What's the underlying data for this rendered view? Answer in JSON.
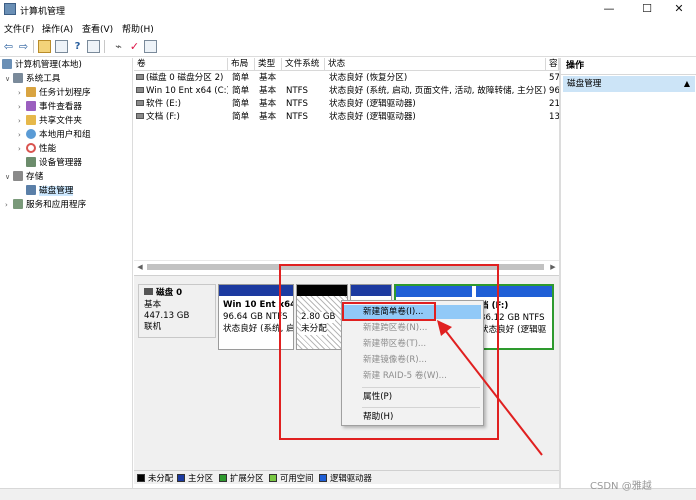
{
  "window": {
    "title": "计算机管理",
    "minimize": "—",
    "maximize": "☐",
    "close": "✕"
  },
  "menu": {
    "items": [
      {
        "label": "文件(F)",
        "name": "menu-file"
      },
      {
        "label": "操作(A)",
        "name": "menu-action"
      },
      {
        "label": "查看(V)",
        "name": "menu-view"
      },
      {
        "label": "帮助(H)",
        "name": "menu-help"
      }
    ]
  },
  "toolbar": {
    "icons": [
      "back-icon",
      "forward-icon",
      "up-folder-icon",
      "show-tree-icon",
      "help-icon",
      "properties-icon",
      "export-icon",
      "checklist-icon",
      "detail-icon"
    ]
  },
  "tree": {
    "items": [
      {
        "label": "计算机管理(本地)",
        "name": "tree-root",
        "level": 0,
        "arrow": "",
        "color": "#6a8fb5"
      },
      {
        "label": "系统工具",
        "name": "tree-system-tools",
        "level": 1,
        "arrow": "∨",
        "color": "#7a8a9a"
      },
      {
        "label": "任务计划程序",
        "name": "tree-task-scheduler",
        "level": 2,
        "arrow": "›",
        "color": "#d9a441"
      },
      {
        "label": "事件查看器",
        "name": "tree-event-viewer",
        "level": 2,
        "arrow": "›",
        "color": "#9b5fbf"
      },
      {
        "label": "共享文件夹",
        "name": "tree-shared-folders",
        "level": 2,
        "arrow": "›",
        "color": "#e6b84a"
      },
      {
        "label": "本地用户和组",
        "name": "tree-local-users",
        "level": 2,
        "arrow": "›",
        "color": "#5a9bd5"
      },
      {
        "label": "性能",
        "name": "tree-performance",
        "level": 2,
        "arrow": "›",
        "color": "#d9534f"
      },
      {
        "label": "设备管理器",
        "name": "tree-device-manager",
        "level": 2,
        "arrow": "",
        "color": "#6c8c6c"
      },
      {
        "label": "存储",
        "name": "tree-storage",
        "level": 1,
        "arrow": "∨",
        "color": "#8a8a8a"
      },
      {
        "label": "磁盘管理",
        "name": "tree-disk-management",
        "level": 2,
        "arrow": "",
        "color": "#5a7fa8",
        "selected": true
      },
      {
        "label": "服务和应用程序",
        "name": "tree-services-apps",
        "level": 1,
        "arrow": "›",
        "color": "#7a9a7a"
      }
    ]
  },
  "volumes": {
    "columns": [
      "卷",
      "布局",
      "类型",
      "文件系统",
      "状态",
      "容"
    ],
    "rows": [
      [
        "(磁盘 0 磁盘分区 2)",
        "简单",
        "基本",
        "",
        "状态良好 (恢复分区)",
        "57"
      ],
      [
        "Win 10 Ent x64 (C:)",
        "简单",
        "基本",
        "NTFS",
        "状态良好 (系统, 启动, 页面文件, 活动, 故障转储, 主分区)",
        "96"
      ],
      [
        "软件 (E:)",
        "简单",
        "基本",
        "NTFS",
        "状态良好 (逻辑驱动器)",
        "21"
      ],
      [
        "文档 (F:)",
        "简单",
        "基本",
        "NTFS",
        "状态良好 (逻辑驱动器)",
        "13"
      ]
    ]
  },
  "disk": {
    "name": "磁盘 0",
    "type": "基本",
    "size": "447.13 GB",
    "status": "联机",
    "partitions": [
      {
        "name": "win-partition",
        "line1": "Win 10 Ent x64",
        "line2": "96.64 GB NTFS",
        "line3": "状态良好 (系统, 启",
        "bar_color": "#1c3aa0"
      },
      {
        "name": "unallocated-partition",
        "line1": "",
        "line2": "2.80 GB",
        "line3": "未分配",
        "bar_color": "#000000"
      },
      {
        "name": "docs-partition",
        "line1": "档 (F:)",
        "line2": "36.12 GB NTFS",
        "line3": "状态良好 (逻辑驱",
        "bar_color": "#1c3aa0"
      }
    ]
  },
  "legend": {
    "items": [
      {
        "label": "未分配",
        "color": "#000000"
      },
      {
        "label": "主分区",
        "color": "#1c3aa0"
      },
      {
        "label": "扩展分区",
        "color": "#2e9a2e"
      },
      {
        "label": "可用空间",
        "color": "#7ac943"
      },
      {
        "label": "逻辑驱动器",
        "color": "#1f5fd6"
      }
    ]
  },
  "actions": {
    "header": "操作",
    "item": "磁盘管理",
    "caret": "▲"
  },
  "context_menu": {
    "items": [
      {
        "label": "新建简单卷(I)...",
        "name": "ctx-new-simple-volume",
        "disabled": false,
        "highlighted": true
      },
      {
        "label": "新建跨区卷(N)...",
        "name": "ctx-new-spanned-volume",
        "disabled": true
      },
      {
        "label": "新建带区卷(T)...",
        "name": "ctx-new-striped-volume",
        "disabled": true
      },
      {
        "label": "新建镜像卷(R)...",
        "name": "ctx-new-mirrored-volume",
        "disabled": true
      },
      {
        "label": "新建 RAID-5 卷(W)...",
        "name": "ctx-new-raid5-volume",
        "disabled": true
      },
      {
        "label": "属性(P)",
        "name": "ctx-properties",
        "disabled": false
      },
      {
        "label": "帮助(H)",
        "name": "ctx-help",
        "disabled": false
      }
    ]
  },
  "annotation_color": "#e02020",
  "watermark": "CSDN @雅越"
}
